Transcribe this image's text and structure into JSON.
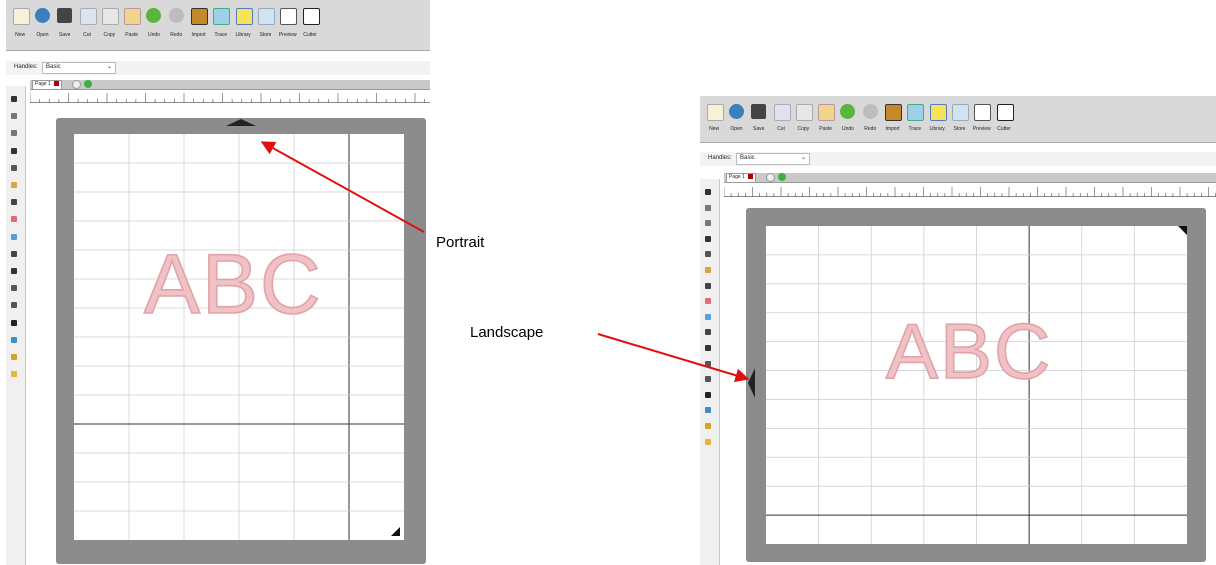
{
  "toolbar_buttons": [
    {
      "label": "New",
      "icon": "new-icon"
    },
    {
      "label": "Open",
      "icon": "open-icon"
    },
    {
      "label": "Save",
      "icon": "save-icon"
    },
    {
      "label": "Cut",
      "icon": "cut-icon"
    },
    {
      "label": "Copy",
      "icon": "copy-icon"
    },
    {
      "label": "Paste",
      "icon": "paste-icon"
    },
    {
      "label": "Undo",
      "icon": "undo-icon"
    },
    {
      "label": "Redo",
      "icon": "redo-icon"
    },
    {
      "label": "Import",
      "icon": "import-icon"
    },
    {
      "label": "Trace",
      "icon": "trace-icon"
    },
    {
      "label": "Library",
      "icon": "library-icon"
    },
    {
      "label": "Store",
      "icon": "store-icon"
    },
    {
      "label": "Preview",
      "icon": "preview-icon"
    },
    {
      "label": "Cutter",
      "icon": "cutter-icon"
    }
  ],
  "handles": {
    "label": "Handles:",
    "value": "Basic"
  },
  "page_tab": {
    "label": "Page 1"
  },
  "portrait": {
    "mat_text": "ABC",
    "annotation": "Portrait"
  },
  "landscape": {
    "mat_text": "ABC",
    "annotation": "Landscape"
  },
  "colors": {
    "arrow": "#e01010",
    "mat": "#8c8c8c",
    "text_stroke": "#e0a3a8",
    "toolbar": "#d9d9d9"
  }
}
